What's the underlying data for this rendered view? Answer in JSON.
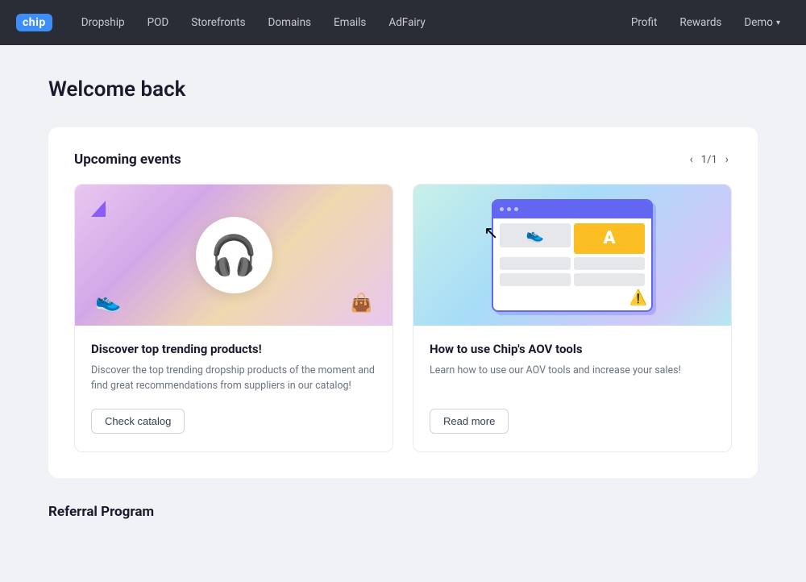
{
  "navbar": {
    "logo": "chip",
    "nav_items": [
      "Dropship",
      "POD",
      "Storefronts",
      "Domains",
      "Emails",
      "AdFairy"
    ],
    "right_items": [
      "Profit",
      "Rewards"
    ],
    "user": "Demo",
    "dropship_label": "Dropship",
    "pod_label": "POD",
    "storefronts_label": "Storefronts",
    "domains_label": "Domains",
    "emails_label": "Emails",
    "adfairy_label": "AdFairy",
    "profit_label": "Profit",
    "rewards_label": "Rewards",
    "demo_label": "Demo"
  },
  "page": {
    "welcome": "Welcome back"
  },
  "upcoming_events": {
    "title": "Upcoming events",
    "pagination": "1/1",
    "cards": [
      {
        "title": "Discover top trending products!",
        "description": "Discover the top trending dropship products of the moment and find great recommendations from suppliers in our catalog!",
        "button_label": "Check catalog"
      },
      {
        "title": "How to use Chip's AOV tools",
        "description": "Learn how to use our AOV tools and increase your sales!",
        "button_label": "Read more"
      }
    ]
  },
  "referral": {
    "title": "Referral Program"
  }
}
